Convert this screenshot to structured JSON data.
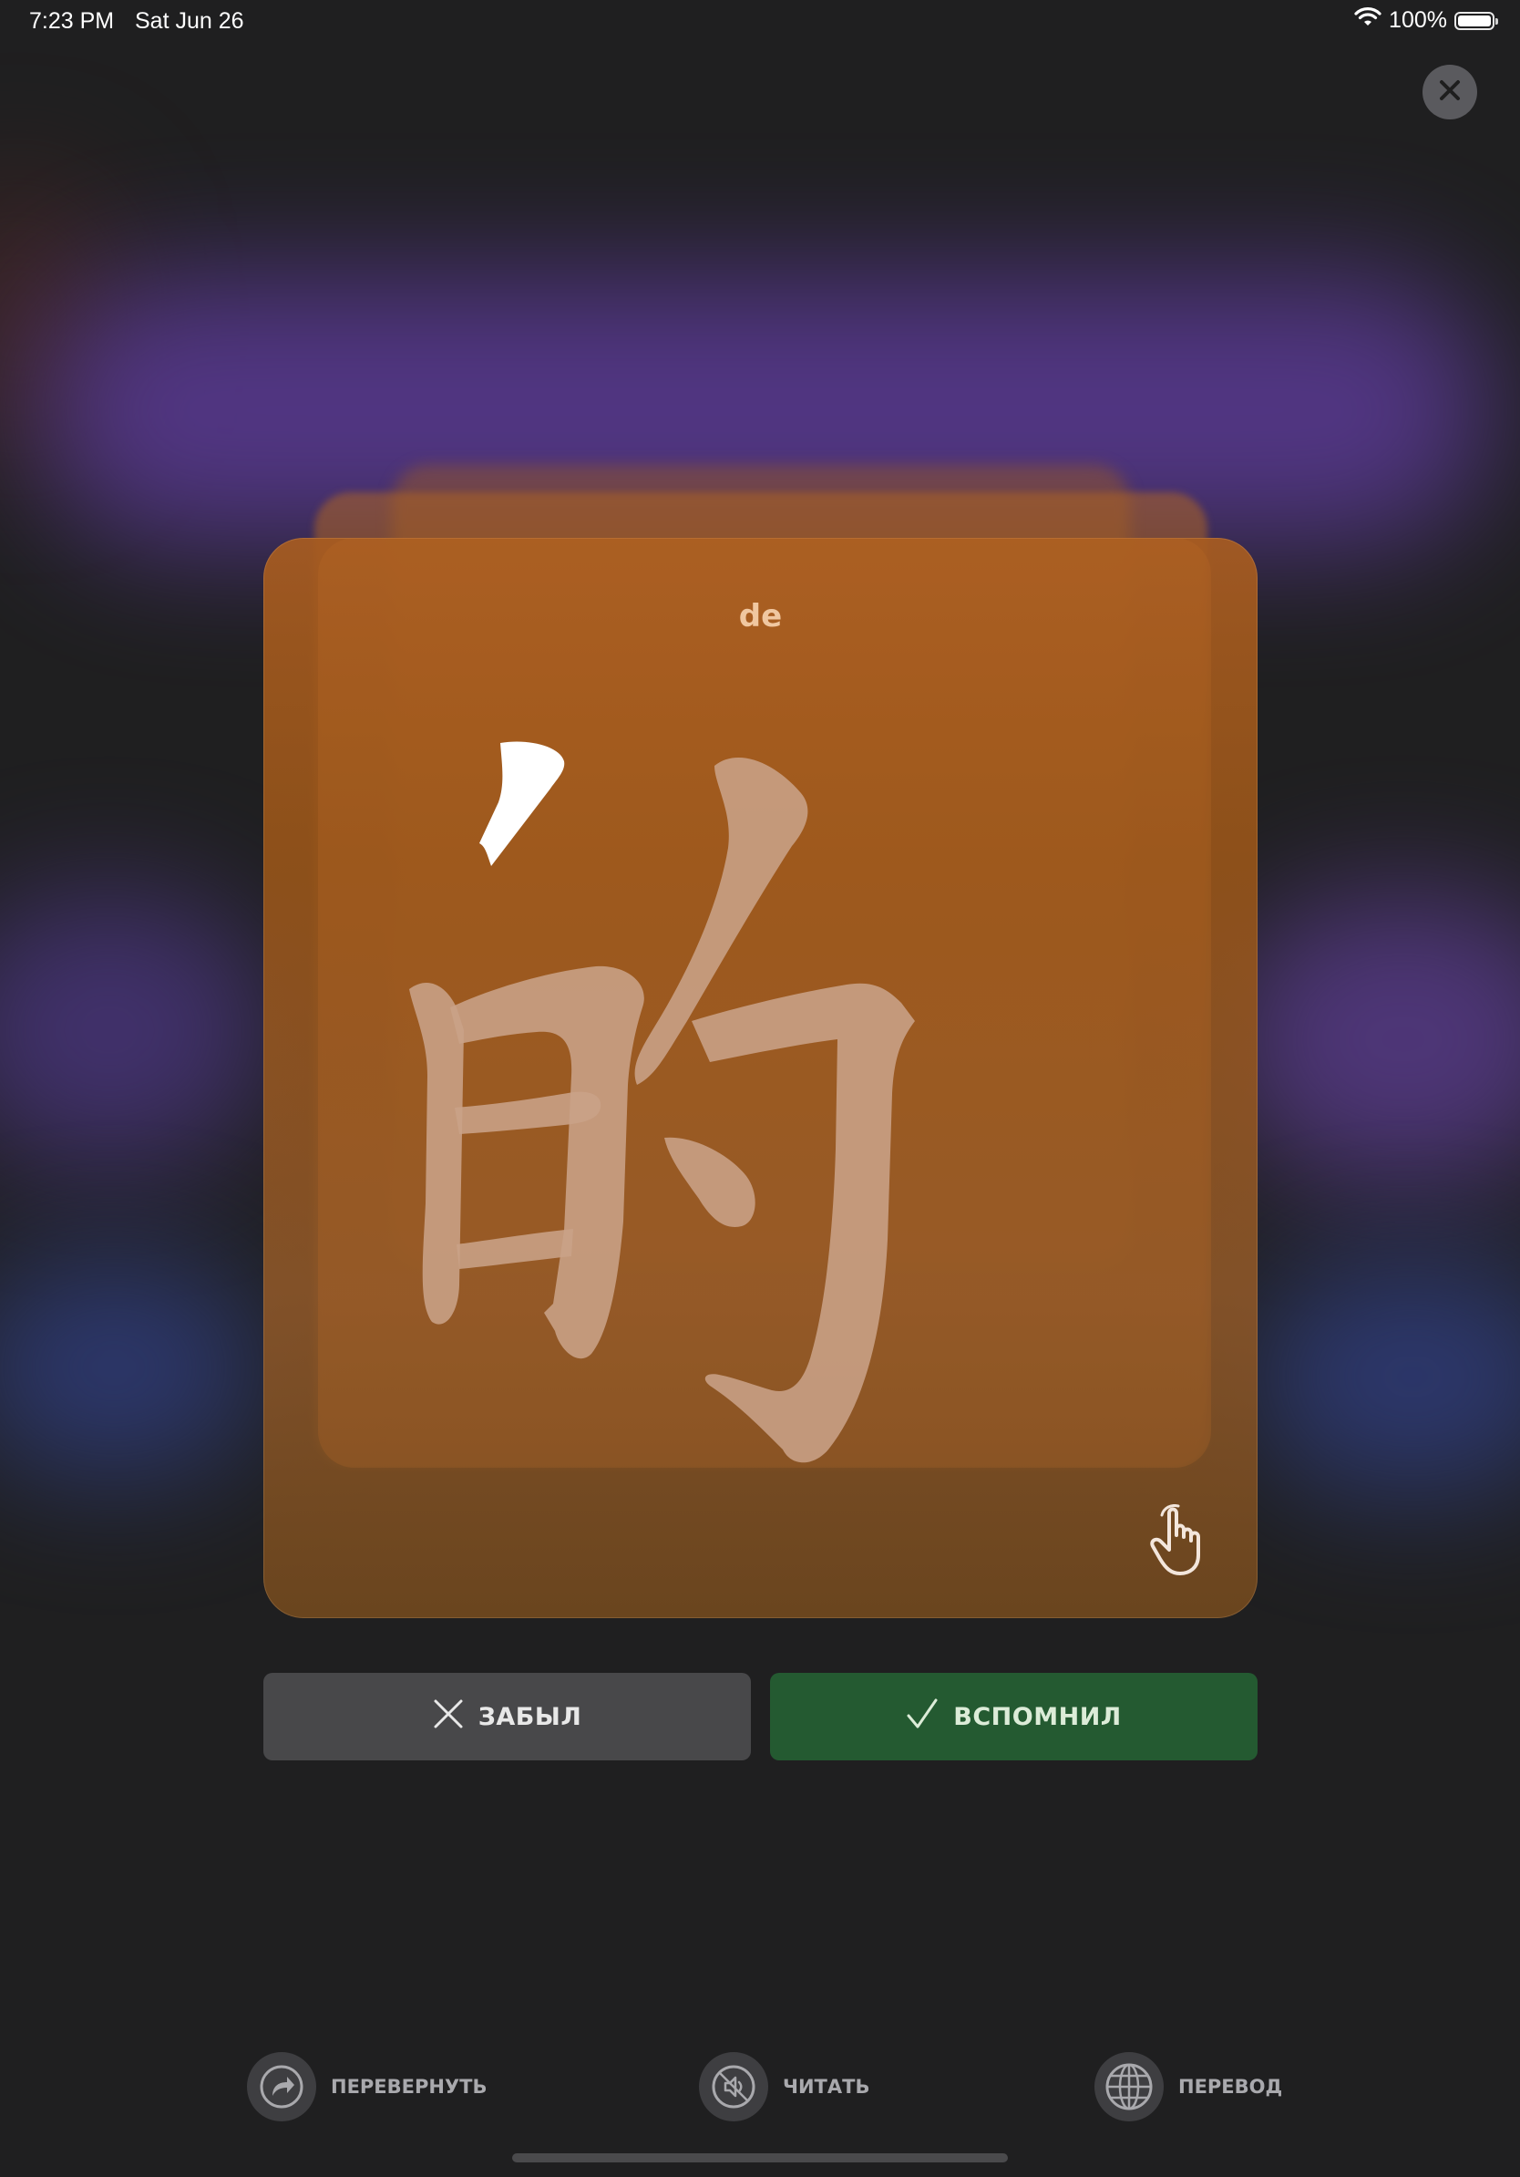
{
  "status_bar": {
    "time": "7:23 PM",
    "date": "Sat Jun 26",
    "battery_text": "100%",
    "battery_level": 1.0,
    "wifi_icon": "wifi-icon",
    "battery_icon": "battery-icon"
  },
  "close_button": {
    "icon": "close-icon"
  },
  "card": {
    "pinyin": "de",
    "character": "的",
    "gesture_icon": "tap-hand-icon",
    "color": "#9a5a22"
  },
  "answers": {
    "forgot_label": "ЗАБЫЛ",
    "forgot_icon": "x-icon",
    "remembered_label": "ВСПОМНИЛ",
    "remembered_icon": "checkmark-icon",
    "remembered_color": "#245a31"
  },
  "toolbar": {
    "flip_label": "ПЕРЕВЕРНУТЬ",
    "flip_icon": "flip-arrow-icon",
    "read_label": "ЧИТАТЬ",
    "read_icon": "speaker-muted-icon",
    "translate_label": "ПЕРЕВОД",
    "translate_icon": "globe-icon"
  }
}
